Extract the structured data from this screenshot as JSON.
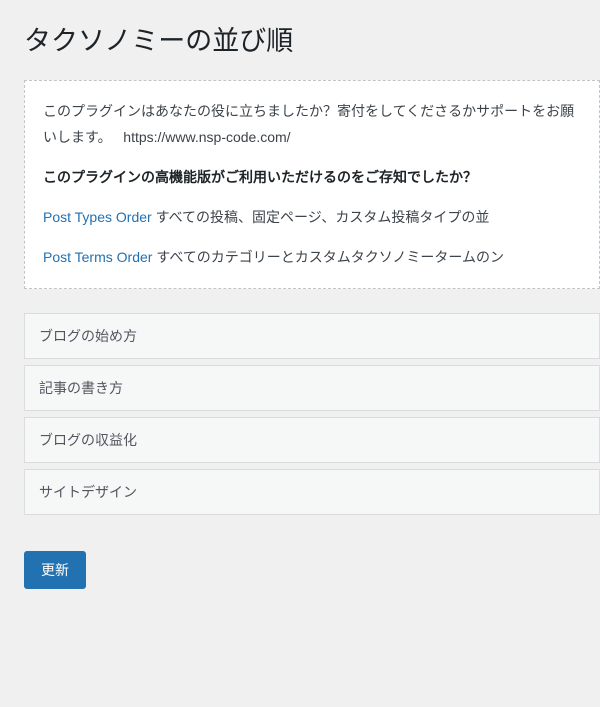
{
  "page": {
    "title": "タクソノミーの並び順"
  },
  "notice": {
    "line1": "このプラグインはあなたの役に立ちましたか？寄付をしてくださるかサポートをお願いします。",
    "support_url": "https://www.nsp-code.com/",
    "line2": "このプラグインの高機能版がご利用いただけるのをご存知でしたか？",
    "link_pto_label": "Post Types Order",
    "link_pto_desc": " すべての投稿、固定ページ、カスタム投稿タイプの並",
    "link_ptermo_label": "Post Terms Order",
    "link_ptermo_desc": " すべてのカテゴリーとカスタムタクソノミータームのン"
  },
  "terms": [
    "ブログの始め方",
    "記事の書き方",
    "ブログの収益化",
    "サイトデザイン"
  ],
  "buttons": {
    "update": "更新"
  }
}
